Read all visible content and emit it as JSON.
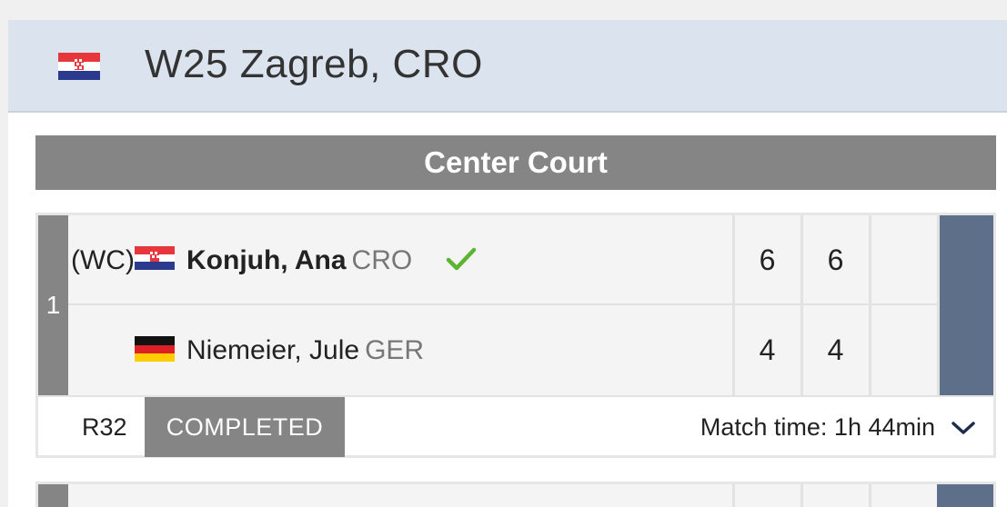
{
  "tournament": {
    "title": "W25 Zagreb, CRO",
    "flag": "croatia-flag"
  },
  "court": {
    "name": "Center Court"
  },
  "match": {
    "order": "1",
    "player1": {
      "seed": "(WC)",
      "flag": "croatia-flag",
      "name": "Konjuh, Ana",
      "nationality": "CRO",
      "winner": true,
      "scores": [
        "6",
        "6",
        ""
      ]
    },
    "player2": {
      "seed": "",
      "flag": "germany-flag",
      "name": "Niemeier, Jule",
      "nationality": "GER",
      "winner": false,
      "scores": [
        "4",
        "4",
        ""
      ]
    },
    "round": "R32",
    "status": "COMPLETED",
    "match_time": "Match time: 1h 44min"
  },
  "colors": {
    "header_bg": "#dbe3ee",
    "court_bar": "#858585",
    "live_column": "#5e7089",
    "check": "#5cb531"
  }
}
